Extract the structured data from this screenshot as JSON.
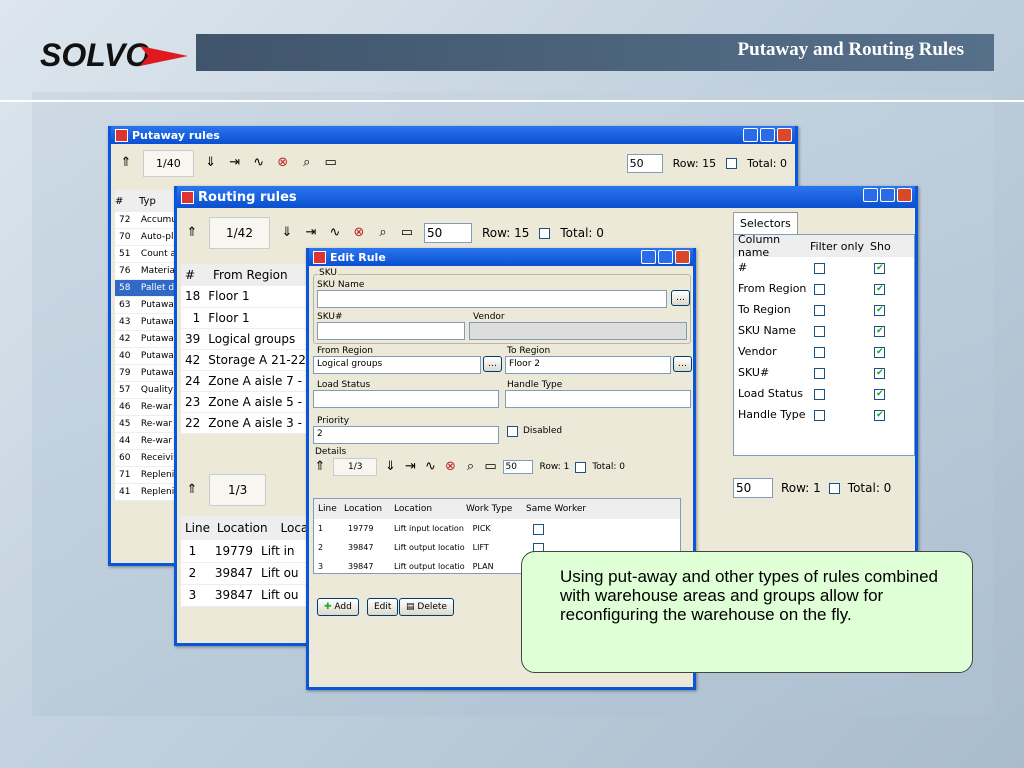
{
  "header": {
    "title": "Putaway and Routing Rules"
  },
  "putaway": {
    "title": "Putaway rules",
    "page": "1/40",
    "rows_per_page": "50",
    "row_label": "Row: 15",
    "total_label": "Total: 0",
    "col_hash": "#",
    "col_type": "Typ",
    "rows": [
      {
        "id": "72",
        "name": "Accumu"
      },
      {
        "id": "70",
        "name": "Auto-pl"
      },
      {
        "id": "51",
        "name": "Count a"
      },
      {
        "id": "76",
        "name": "Materia"
      },
      {
        "id": "58",
        "name": "Pallet d"
      },
      {
        "id": "63",
        "name": "Putawa"
      },
      {
        "id": "43",
        "name": "Putawa"
      },
      {
        "id": "42",
        "name": "Putawa"
      },
      {
        "id": "40",
        "name": "Putawa"
      },
      {
        "id": "79",
        "name": "Putawa"
      },
      {
        "id": "57",
        "name": "Quality"
      },
      {
        "id": "46",
        "name": "Re-war"
      },
      {
        "id": "45",
        "name": "Re-war"
      },
      {
        "id": "44",
        "name": "Re-war"
      },
      {
        "id": "60",
        "name": "Receivi"
      },
      {
        "id": "71",
        "name": "Repleni"
      },
      {
        "id": "41",
        "name": "Repleni"
      }
    ]
  },
  "routing": {
    "title": "Routing rules",
    "page": "1/42",
    "rows_per_page": "50",
    "row_label": "Row: 15",
    "total_label": "Total: 0",
    "col_hash": "#",
    "col_from": "From Region",
    "rows": [
      {
        "id": "18",
        "from": "Floor 1"
      },
      {
        "id": "1",
        "from": "Floor 1"
      },
      {
        "id": "39",
        "from": "Logical groups"
      },
      {
        "id": "42",
        "from": "Storage A 21-22"
      },
      {
        "id": "24",
        "from": "Zone A aisle 7 - 8"
      },
      {
        "id": "23",
        "from": "Zone A aisle 5 - 6"
      },
      {
        "id": "22",
        "from": "Zone A aisle 3 - 4"
      }
    ],
    "detail_page": "1/3",
    "detail_rows_per_page": "50",
    "detail_row_label": "Row: 1",
    "detail_total_label": "Total: 0",
    "col_line": "Line",
    "col_location": "Location",
    "col_loc2": "Locat",
    "detail_rows": [
      {
        "line": "1",
        "loc": "19779",
        "t": "Lift in"
      },
      {
        "line": "2",
        "loc": "39847",
        "t": "Lift ou"
      },
      {
        "line": "3",
        "loc": "39847",
        "t": "Lift ou"
      }
    ]
  },
  "selectors": {
    "tab": "Selectors",
    "col_name": "Column name",
    "col_filter": "Filter only",
    "col_show": "Sho",
    "items": [
      {
        "name": "#",
        "filter": false,
        "show": true
      },
      {
        "name": "From Region",
        "filter": false,
        "show": true
      },
      {
        "name": "To Region",
        "filter": false,
        "show": true
      },
      {
        "name": "SKU Name",
        "filter": false,
        "show": true
      },
      {
        "name": "Vendor",
        "filter": false,
        "show": true
      },
      {
        "name": "SKU#",
        "filter": false,
        "show": true
      },
      {
        "name": "Load Status",
        "filter": false,
        "show": true
      },
      {
        "name": "Handle Type",
        "filter": false,
        "show": true
      }
    ]
  },
  "edit": {
    "title": "Edit Rule",
    "sku_group": "SKU",
    "sku_name": "SKU Name",
    "sku_num": "SKU#",
    "vendor": "Vendor",
    "from_region": "From Region",
    "from_region_value": "Logical groups",
    "to_region": "To Region",
    "to_region_value": "Floor 2",
    "load_status": "Load Status",
    "handle_type": "Handle Type",
    "priority": "Priority",
    "priority_value": "2",
    "disabled": "Disabled",
    "details": "Details",
    "page": "1/3",
    "rows_per_page": "50",
    "row_label": "Row: 1",
    "total_label": "Total: 0",
    "col_line": "Line",
    "col_location": "Location",
    "col_work": "Work Type",
    "col_same": "Same Worker",
    "rows": [
      {
        "line": "1",
        "loc": "19779",
        "desc": "Lift input location",
        "work": "PICK"
      },
      {
        "line": "2",
        "loc": "39847",
        "desc": "Lift output locatio",
        "work": "LIFT"
      },
      {
        "line": "3",
        "loc": "39847",
        "desc": "Lift output locatio",
        "work": "PLAN"
      }
    ],
    "add": "Add",
    "edit": "Edit",
    "delete": "Delete"
  },
  "callout": {
    "text": "Using put-away and other types of rules combined with warehouse areas and groups allow for reconfiguring the warehouse on the fly."
  }
}
